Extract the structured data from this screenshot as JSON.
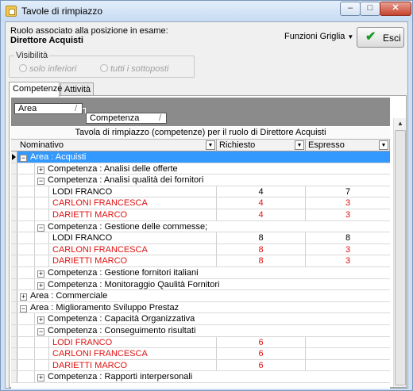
{
  "window": {
    "title": "Tavole di rimpiazzo",
    "min": "–",
    "max": "□",
    "close": "✕"
  },
  "header": {
    "role_caption": "Ruolo associato alla posizione in esame:",
    "role_value": "Direttore Acquisti",
    "grid_functions": "Funzioni Griglia",
    "exit_label": "Esci"
  },
  "visibility": {
    "legend": "Visibilità",
    "option1": "solo inferiori",
    "option2": "tutti i sottoposti"
  },
  "tabs": [
    "Competenze",
    "Attività"
  ],
  "grid": {
    "group_chips": [
      "Area",
      "Competenza"
    ],
    "title": "Tavola di rimpiazzo (competenze) per il ruolo di Direttore Acquisti",
    "columns": [
      "Nominativo",
      "Richiesto",
      "Espresso"
    ],
    "rows": [
      {
        "type": "area",
        "exp": "−",
        "text": "Area : Acquisti",
        "current": true
      },
      {
        "type": "comp",
        "exp": "+",
        "text": "Competenza : Analisi delle offerte"
      },
      {
        "type": "comp",
        "exp": "−",
        "text": "Competenza : Analisi qualità dei fornitori"
      },
      {
        "type": "person",
        "name": "LODI FRANCO",
        "ric": "4",
        "esp": "7",
        "red": false
      },
      {
        "type": "person",
        "name": "CARLONI FRANCESCA",
        "ric": "4",
        "esp": "3",
        "red": true
      },
      {
        "type": "person",
        "name": "DARIETTI MARCO",
        "ric": "4",
        "esp": "3",
        "red": true
      },
      {
        "type": "comp",
        "exp": "−",
        "text": "Competenza : Gestione delle commesse;"
      },
      {
        "type": "person",
        "name": "LODI FRANCO",
        "ric": "8",
        "esp": "8",
        "red": false
      },
      {
        "type": "person",
        "name": "CARLONI FRANCESCA",
        "ric": "8",
        "esp": "3",
        "red": true
      },
      {
        "type": "person",
        "name": "DARIETTI MARCO",
        "ric": "8",
        "esp": "3",
        "red": true
      },
      {
        "type": "comp",
        "exp": "+",
        "text": "Competenza : Gestione fornitori italiani"
      },
      {
        "type": "comp",
        "exp": "+",
        "text": "Competenza : Monitoraggio Qaulità Fornitori"
      },
      {
        "type": "area",
        "exp": "+",
        "text": "Area : Commerciale"
      },
      {
        "type": "area",
        "exp": "−",
        "text": "Area : Miglioramento Sviluppo Prestaz"
      },
      {
        "type": "comp",
        "exp": "+",
        "text": "Competenza : Capacità Organizzativa"
      },
      {
        "type": "comp",
        "exp": "−",
        "text": "Competenza : Conseguimento risultati"
      },
      {
        "type": "person",
        "name": "LODI FRANCO",
        "ric": "6",
        "esp": "",
        "red": true
      },
      {
        "type": "person",
        "name": "CARLONI FRANCESCA",
        "ric": "6",
        "esp": "",
        "red": true
      },
      {
        "type": "person",
        "name": "DARIETTI MARCO",
        "ric": "6",
        "esp": "",
        "red": true
      },
      {
        "type": "comp",
        "exp": "+",
        "text": "Competenza : Rapporti interpersonali"
      }
    ]
  }
}
